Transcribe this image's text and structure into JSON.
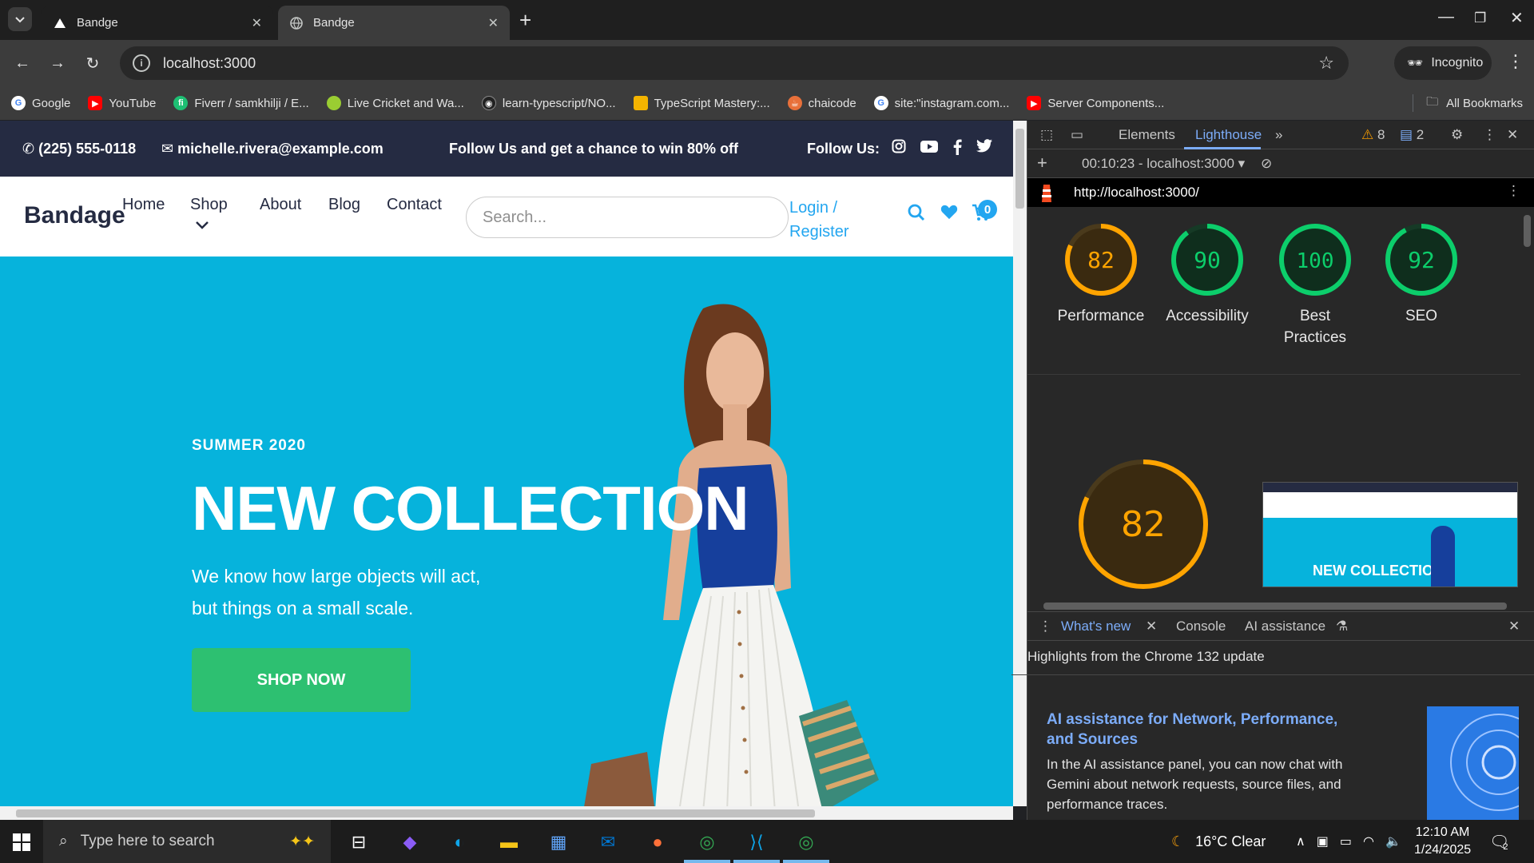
{
  "browser": {
    "tabs": [
      {
        "title": "Bandge",
        "active": false
      },
      {
        "title": "Bandge",
        "active": true
      }
    ],
    "address": "localhost:3000",
    "incognito_label": "Incognito",
    "bookmarks": [
      {
        "label": "Google",
        "color": "#4285F4",
        "glyph": "G"
      },
      {
        "label": "YouTube",
        "color": "#FF0000",
        "glyph": "▶"
      },
      {
        "label": "Fiverr / samkhilji / E...",
        "color": "#1DBF73",
        "glyph": "fi"
      },
      {
        "label": "Live Cricket and Wa...",
        "color": "#9ACD32",
        "glyph": "●"
      },
      {
        "label": "learn-typescript/NO...",
        "color": "#333333",
        "glyph": "◉"
      },
      {
        "label": "TypeScript Mastery:...",
        "color": "#F4B400",
        "glyph": "▭"
      },
      {
        "label": "chaicode",
        "color": "#E8703A",
        "glyph": "☕"
      },
      {
        "label": "site:\"instagram.com...",
        "color": "#4285F4",
        "glyph": "G"
      },
      {
        "label": "Server Components...",
        "color": "#FF0000",
        "glyph": "▶"
      }
    ],
    "all_bookmarks_label": "All Bookmarks"
  },
  "site": {
    "topbar": {
      "phone": "(225) 555-0118",
      "email": "michelle.rivera@example.com",
      "promo": "Follow Us and get a chance to win 80% off",
      "follow": "Follow Us:"
    },
    "brand": "Bandage",
    "nav": [
      "Home",
      "Shop",
      "About",
      "Blog",
      "Contact"
    ],
    "search_placeholder": "Search...",
    "login": "Login /",
    "register": "Register",
    "cart_count": "0",
    "hero": {
      "season": "SUMMER 2020",
      "headline": "NEW COLLECTION",
      "subtext_line1": "We know how large objects will act,",
      "subtext_line2": "but things on a small scale.",
      "cta": "SHOP NOW",
      "bg_color": "#06B3DC"
    },
    "colors": {
      "primary": "#23A6F0",
      "dark": "#252B42",
      "success": "#2DC071"
    }
  },
  "devtools": {
    "tabs": [
      "Elements",
      "Lighthouse"
    ],
    "issues_warn": "8",
    "issues_msg": "2",
    "report_time": "00:10:23 - localhost:3000",
    "report_url": "http://localhost:3000/",
    "scores": [
      {
        "value": 82,
        "label1": "Performance",
        "label2": "",
        "color": "#FFA400"
      },
      {
        "value": 90,
        "label1": "Accessibility",
        "label2": "",
        "color": "#0CCE6B"
      },
      {
        "value": 100,
        "label1": "Best",
        "label2": "Practices",
        "color": "#0CCE6B"
      },
      {
        "value": 92,
        "label1": "SEO",
        "label2": "",
        "color": "#0CCE6B"
      }
    ],
    "big_score": {
      "value": 82,
      "color": "#FFA400"
    },
    "thumb_headline": "NEW COLLECTION",
    "drawer": {
      "tabs": [
        "What's new",
        "Console",
        "AI assistance"
      ],
      "highlights": "Highlights from the Chrome 132 update",
      "ai_title": "AI assistance for Network, Performance, and Sources",
      "ai_text": "In the AI assistance panel, you can now chat with Gemini about network requests, source files, and performance traces."
    }
  },
  "taskbar": {
    "search_placeholder": "Type here to search",
    "weather": "16°C  Clear",
    "time": "12:10 AM",
    "date": "1/24/2025",
    "notif_count": "2"
  }
}
